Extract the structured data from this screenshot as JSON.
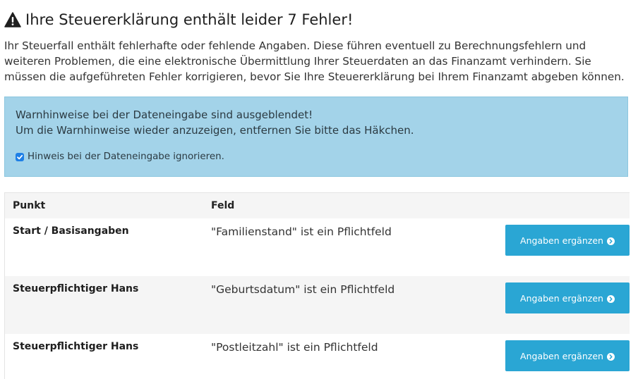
{
  "header": {
    "title": "Ihre Steuererklärung enthält leider 7 Fehler!",
    "icon": "warning-triangle-icon"
  },
  "intro": {
    "text": "Ihr Steuerfall enthält fehlerhafte oder fehlende Angaben. Diese führen eventuell zu Berechnungsfehlern und weiteren Problemen, die eine elektronische Übermittlung Ihrer Steuerdaten an das Finanzamt verhindern. Sie müssen die aufgeführeten Fehler korrigieren, bevor Sie Ihre Steuererklärung bei Ihrem Finanzamt abgeben können."
  },
  "info": {
    "line1": "Warnhinweise bei der Dateneingabe sind ausgeblendet!",
    "line2": "Um die Warnhinweise wieder anzuzeigen, entfernen Sie bitte das Häkchen.",
    "checkbox_label": "Hinweis bei der Dateneingabe ignorieren.",
    "checkbox_checked": true
  },
  "table": {
    "columns": [
      "Punkt",
      "Feld"
    ],
    "rows": [
      {
        "punkt": "Start / Basisangaben",
        "feld": "\"Familienstand\" ist ein Pflichtfeld",
        "button": "Angaben ergänzen"
      },
      {
        "punkt": "Steuerpflichtiger Hans",
        "feld": "\"Geburtsdatum\" ist ein Pflichtfeld",
        "button": "Angaben ergänzen"
      },
      {
        "punkt": "Steuerpflichtiger Hans",
        "feld": "\"Postleitzahl\" ist ein Pflichtfeld",
        "button": "Angaben ergänzen"
      }
    ]
  },
  "colors": {
    "info_background": "#a3d3e9",
    "button_background": "#2aa6d4",
    "checkbox": "#1e7fe6"
  }
}
